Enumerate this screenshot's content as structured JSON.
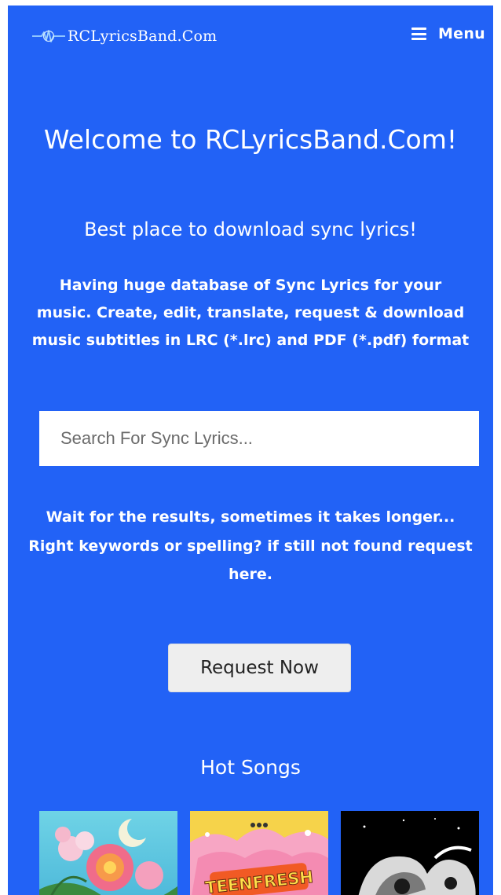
{
  "header": {
    "logo_text": "RCLyricsBand.Com",
    "menu_label": "Menu"
  },
  "hero": {
    "title": "Welcome to RCLyricsBand.Com!",
    "subtitle": "Best place to download sync lyrics!",
    "description": "Having huge database of Sync Lyrics for your music. Create, edit, translate, request & download music subtitles in LRC (*.lrc) and PDF (*.pdf) format"
  },
  "search": {
    "placeholder": "Search For Sync Lyrics..."
  },
  "notice": {
    "line1": "Wait for the results, sometimes it takes longer...",
    "line2": "Right keywords or spelling? if still not found request here."
  },
  "request_button": {
    "label": "Request Now"
  },
  "hot_songs": {
    "title": "Hot Songs",
    "covers": [
      {
        "icon": "floral-album-cover"
      },
      {
        "icon": "teenfresh-album-cover",
        "text": "TEENFRESH"
      },
      {
        "icon": "monochrome-album-cover"
      }
    ]
  },
  "colors": {
    "background": "#2262f6",
    "text": "#ffffff",
    "button_bg": "#eeeeee"
  }
}
